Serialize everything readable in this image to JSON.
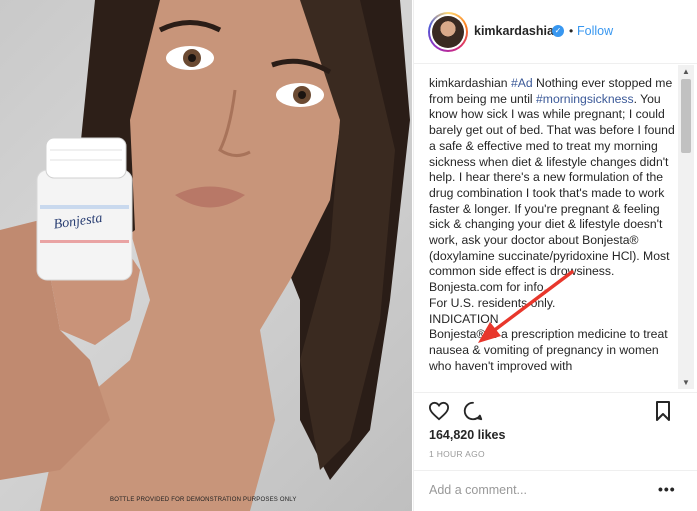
{
  "photo": {
    "disclaimer": "BOTTLE PROVIDED FOR DEMONSTRATION PURPOSES ONLY",
    "bottle_label": "Bonjesta"
  },
  "header": {
    "username": "kimkardashian",
    "verified_icon": "verified-badge-icon",
    "separator": "•",
    "follow_label": "Follow"
  },
  "caption": {
    "username": "kimkardashian",
    "tag_ad": "#Ad",
    "text_1": " Nothing ever stopped me from being me until ",
    "tag_morningsickness": "#morningsickness",
    "text_2": ". You know how sick I was while pregnant; I could barely get out of bed. That was before I found a safe & effective med to treat my morning sickness when diet & lifestyle changes didn't help. I hear there's a new formulation of the drug combination I took that's made to work faster & longer. If you're pregnant & feeling sick & changing your diet & lifestyle doesn't work, ask your doctor about Bonjesta® (doxylamine succinate/pyridoxine HCl). Most common side effect is drowsiness. Bonjesta.com for info.",
    "text_3": "For U.S. residents only.",
    "text_4": "INDICATION",
    "text_5": "Bonjesta® is a prescription medicine to treat nausea & vomiting of pregnancy in women who haven't improved with"
  },
  "actions": {
    "like_icon": "heart-icon",
    "comment_icon": "comment-icon",
    "save_icon": "bookmark-icon"
  },
  "likes": "164,820 likes",
  "time": "1 HOUR AGO",
  "comment": {
    "placeholder": "Add a comment...",
    "more_label": "•••"
  },
  "colors": {
    "link": "#3897f0",
    "arrow": "#e8372c"
  }
}
